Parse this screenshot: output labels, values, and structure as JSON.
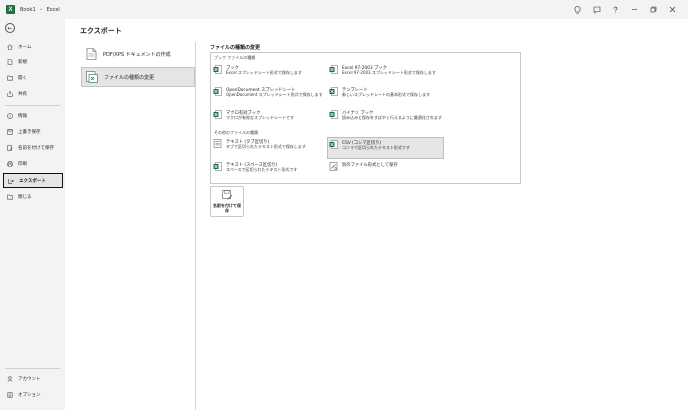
{
  "titlebar": {
    "logo_letter": "X",
    "workbook": "Book1",
    "separator": "•",
    "app": "Excel"
  },
  "nav": {
    "back": "←",
    "items": [
      {
        "label": "ホーム",
        "icon": "home-icon"
      },
      {
        "label": "新規",
        "icon": "new-file-icon"
      },
      {
        "label": "開く",
        "icon": "folder-open-icon"
      },
      {
        "label": "共有",
        "icon": "share-icon"
      },
      {
        "label": "情報",
        "icon": "info-icon"
      },
      {
        "label": "上書き保存",
        "icon": "save-icon"
      },
      {
        "label": "名前を付けて保存",
        "icon": "save-as-icon"
      },
      {
        "label": "印刷",
        "icon": "print-icon"
      },
      {
        "label": "エクスポート",
        "icon": "export-icon",
        "active": true
      },
      {
        "label": "閉じる",
        "icon": "close-folder-icon"
      }
    ],
    "bottom": [
      {
        "label": "アカウント",
        "icon": "account-icon"
      },
      {
        "label": "オプション",
        "icon": "options-icon"
      }
    ]
  },
  "main": {
    "title": "エクスポート",
    "options": [
      {
        "label": "PDF/XPS ドキュメントの作成",
        "icon": "pdf-document-icon"
      },
      {
        "label": "ファイルの種類の変更",
        "icon": "change-file-type-icon",
        "selected": true
      }
    ],
    "file_types": {
      "section_title": "ファイルの種類の変更",
      "workbook_group": "ブック ファイルの種類",
      "other_group": "その他のファイルの種類",
      "items": [
        {
          "title": "ブック",
          "desc": "Excel スプレッドシート形式で保存します"
        },
        {
          "title": "Excel 97-2003 ブック",
          "desc": "Excel 97-2003 スプレッドシート形式で保存します"
        },
        {
          "title": "OpenDocument スプレッドシート",
          "desc": "OpenDocument スプレッドシート形式で保存します"
        },
        {
          "title": "テンプレート",
          "desc": "新しいスプレッドシートの基本形式で保存します"
        },
        {
          "title": "マクロ有効ブック",
          "desc": "マクロが有効なスプレッドシートです"
        },
        {
          "title": "バイナリ ブック",
          "desc": "読み込みと保存をすばやく行えるように最適化されます"
        },
        {
          "title": "テキスト (タブ区切り)",
          "desc": "タブで区切られたテキスト形式で保存します"
        },
        {
          "title": "CSV (コンマ区切り)",
          "desc": "コンマで区切られたテキスト形式です",
          "selected": true
        },
        {
          "title": "テキスト (スペース区切り)",
          "desc": "スペースで区切られたテキスト形式です"
        },
        {
          "title": "別のファイル形式として保存",
          "desc": ""
        }
      ]
    },
    "save_as_button": "名前を付けて保存"
  },
  "colors": {
    "excel_green": "#1d6f42",
    "active_border": "#111111",
    "selected_bg": "#e5e5e5"
  }
}
